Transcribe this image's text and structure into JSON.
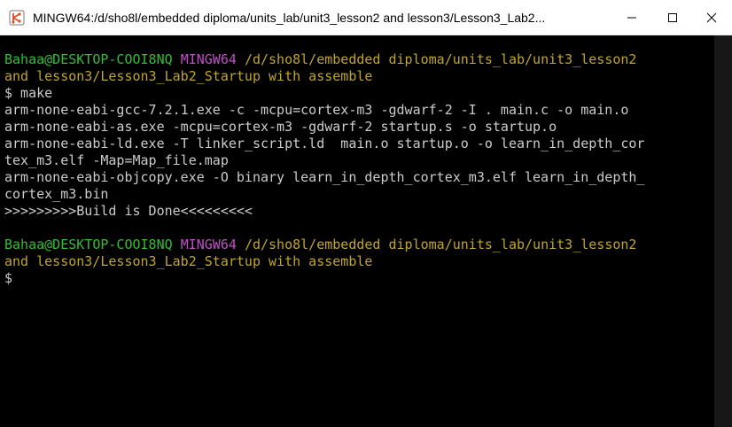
{
  "window": {
    "title": "MINGW64:/d/sho8l/embedded diploma/units_lab/unit3_lesson2 and lesson3/Lesson3_Lab2...",
    "icons": {
      "app": "git-bash-icon",
      "minimize": "minimize-icon",
      "maximize": "maximize-icon",
      "close": "close-icon"
    }
  },
  "colors": {
    "prompt_user": "#33bd33",
    "prompt_shell": "#c050c8",
    "prompt_path": "#c0a52a",
    "text": "#cccccc",
    "background": "#000000"
  },
  "terminal": {
    "prompt1": {
      "user": "Bahaa@DESKTOP-COOI8NQ",
      "shell": "MINGW64",
      "path_line1": "/d/sho8l/embedded diploma/units_lab/unit3_lesson2",
      "path_line2": "and lesson3/Lesson3_Lab2_Startup with assemble"
    },
    "command": "$ make",
    "output": [
      "arm-none-eabi-gcc-7.2.1.exe -c -mcpu=cortex-m3 -gdwarf-2 -I . main.c -o main.o",
      "arm-none-eabi-as.exe -mcpu=cortex-m3 -gdwarf-2 startup.s -o startup.o",
      "arm-none-eabi-ld.exe -T linker_script.ld  main.o startup.o -o learn_in_depth_cor",
      "tex_m3.elf -Map=Map_file.map",
      "arm-none-eabi-objcopy.exe -O binary learn_in_depth_cortex_m3.elf learn_in_depth_",
      "cortex_m3.bin",
      ">>>>>>>>>Build is Done<<<<<<<<<"
    ],
    "prompt2": {
      "user": "Bahaa@DESKTOP-COOI8NQ",
      "shell": "MINGW64",
      "path_line1": "/d/sho8l/embedded diploma/units_lab/unit3_lesson2",
      "path_line2": "and lesson3/Lesson3_Lab2_Startup with assemble"
    },
    "cursor_prompt": "$"
  }
}
